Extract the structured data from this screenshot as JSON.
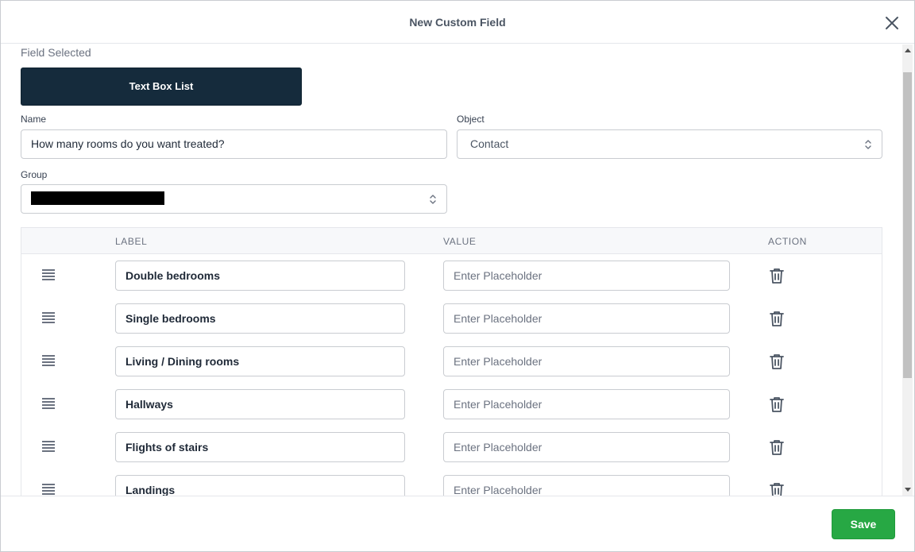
{
  "modal": {
    "title": "New Custom Field"
  },
  "field_selected": {
    "label": "Field Selected",
    "type_name": "Text Box List"
  },
  "form": {
    "name_label": "Name",
    "name_value": "How many rooms do you want treated?",
    "object_label": "Object",
    "object_value": "Contact",
    "group_label": "Group",
    "group_value": ""
  },
  "table": {
    "headers": {
      "label": "LABEL",
      "value": "VALUE",
      "action": "ACTION"
    },
    "rows": [
      {
        "label": "Double bedrooms",
        "value_placeholder": "Enter Placeholder"
      },
      {
        "label": "Single bedrooms",
        "value_placeholder": "Enter Placeholder"
      },
      {
        "label": "Living / Dining rooms",
        "value_placeholder": "Enter Placeholder"
      },
      {
        "label": "Hallways",
        "value_placeholder": "Enter Placeholder"
      },
      {
        "label": "Flights of stairs",
        "value_placeholder": "Enter Placeholder"
      },
      {
        "label": "Landings",
        "value_placeholder": "Enter Placeholder"
      }
    ]
  },
  "footer": {
    "save_label": "Save"
  },
  "icons": {
    "close": "close-icon",
    "select_arrows": "chevron-up-down-icon",
    "drag": "drag-handle-icon",
    "trash": "trash-icon"
  },
  "colors": {
    "type_card": "#152b3c",
    "save_button": "#27a844"
  }
}
